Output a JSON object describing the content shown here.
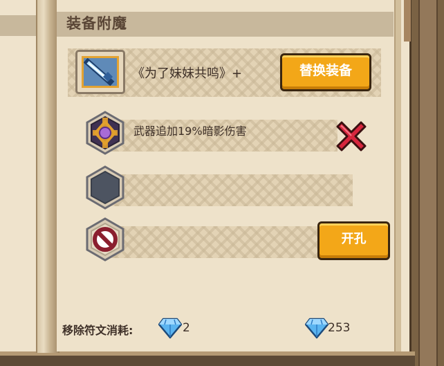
{
  "section_title": "装备附魔",
  "equipment": {
    "name": "《为了妹妹共鸣》+",
    "icon": "sword-icon",
    "replace_button": "替换装备"
  },
  "slots": [
    {
      "state": "filled",
      "icon": "shadow-rune-icon",
      "text": "武器追加19%暗影伤害",
      "action_icon": "remove-x-icon"
    },
    {
      "state": "empty",
      "icon": "empty-hex-slot-icon",
      "text": ""
    },
    {
      "state": "locked",
      "icon": "forbidden-icon",
      "text": "",
      "action_button": "开孔"
    }
  ],
  "footer": {
    "remove_cost_label": "移除符文消耗:",
    "remove_cost_value": "2",
    "owned_gems": "253",
    "gem_icon": "diamond-icon"
  },
  "colors": {
    "button_gold": "#f3a718",
    "remove_red": "#d7263d",
    "gem_blue": "#5ab4f0"
  }
}
